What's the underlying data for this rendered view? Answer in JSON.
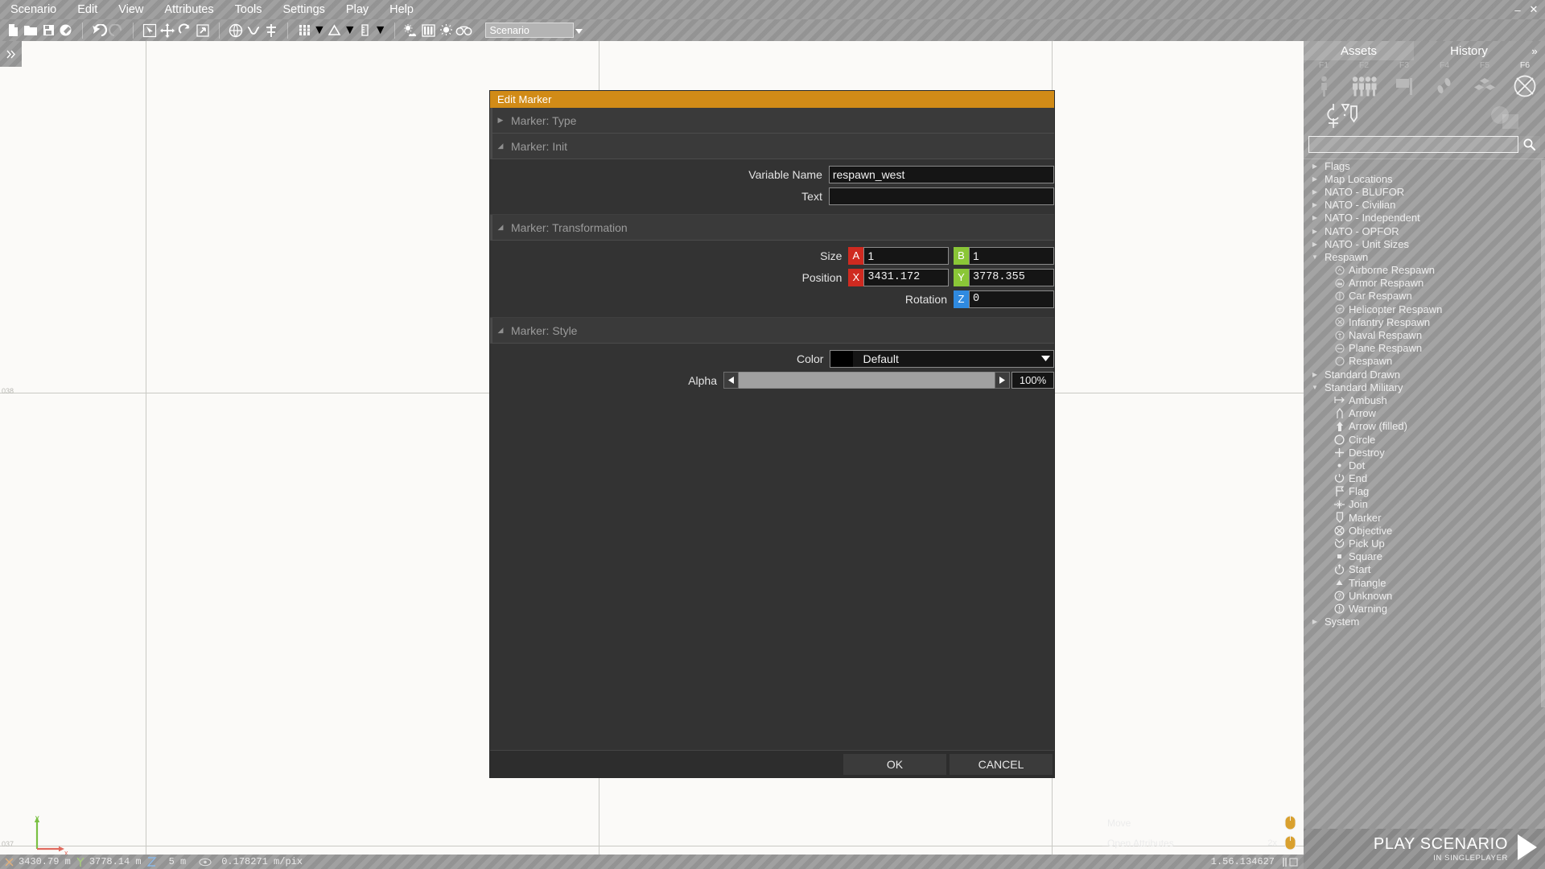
{
  "window": {
    "minimize": "–",
    "maximize": "▫",
    "close": "✕"
  },
  "menubar": {
    "items": [
      "Scenario",
      "Edit",
      "View",
      "Attributes",
      "Tools",
      "Settings",
      "Play",
      "Help"
    ]
  },
  "toolbar": {
    "scenario_combo_value": "Scenario",
    "icons": [
      "new-file-icon",
      "open-folder-icon",
      "save-icon",
      "save-as-icon",
      "undo-icon",
      "redo-icon",
      "select-tool-icon",
      "move-tool-icon",
      "rotate-tool-icon",
      "scale-tool-icon",
      "globe-icon",
      "connect-icon",
      "align-icon",
      "grid-icon",
      "terrain-icon",
      "ruler-icon",
      "environment-icon",
      "texture-icon",
      "lighting-icon",
      "preview-icon"
    ]
  },
  "map": {
    "grid_labels": [
      "038",
      "037"
    ],
    "axis_labels": [
      "y",
      "x"
    ],
    "left_handle_icon": "expand-right-icon"
  },
  "dialog": {
    "title": "Edit Marker",
    "groups": [
      {
        "label": "Marker: Type",
        "expanded": false
      },
      {
        "label": "Marker: Init",
        "expanded": true
      },
      {
        "label": "Marker: Transformation",
        "expanded": true
      },
      {
        "label": "Marker: Style",
        "expanded": true
      }
    ],
    "init": {
      "variable_name_label": "Variable Name",
      "variable_name_value": "respawn_west",
      "text_label": "Text",
      "text_value": "",
      "text_placeholder": ""
    },
    "transformation": {
      "size_label": "Size",
      "size_a_tag": "A",
      "size_a_value": "1",
      "size_b_tag": "B",
      "size_b_value": "1",
      "position_label": "Position",
      "position_x_tag": "X",
      "position_x_value": "3431.172",
      "position_y_tag": "Y",
      "position_y_value": "3778.355",
      "rotation_label": "Rotation",
      "rotation_z_tag": "Z",
      "rotation_z_value": "0"
    },
    "style": {
      "color_label": "Color",
      "color_value": "Default",
      "color_swatch_hex": "#000000",
      "alpha_label": "Alpha",
      "alpha_value": "100%",
      "alpha_percent": 100,
      "decrement_icon": "caret-left-icon",
      "increment_icon": "caret-right-icon",
      "dropdown_icon": "caret-down-icon"
    },
    "buttons": {
      "ok": "OK",
      "cancel": "CANCEL"
    },
    "accent_hex": "#d18b17"
  },
  "right_panel": {
    "tabs": [
      {
        "label": "Assets",
        "active": true
      },
      {
        "label": "History",
        "active": false
      }
    ],
    "expand_icon": "chevron-double-right-icon",
    "fkeys": [
      {
        "label": "F1",
        "active": false
      },
      {
        "label": "F2",
        "active": false
      },
      {
        "label": "F3",
        "active": false
      },
      {
        "label": "F4",
        "active": false
      },
      {
        "label": "F5",
        "active": false
      },
      {
        "label": "F6",
        "active": true
      }
    ],
    "category_icons": [
      "single-unit-icon",
      "group-icon",
      "flag-icon",
      "waypoint-icon",
      "props-icon",
      "marker-crossed-icon"
    ],
    "subcategory_icons": [
      "marker-edit-icon",
      "module-icon"
    ],
    "search": {
      "value": "",
      "placeholder": "",
      "icon": "search-icon"
    },
    "tree": [
      {
        "label": "Flags",
        "type": "branch",
        "expanded": false
      },
      {
        "label": "Map Locations",
        "type": "branch",
        "expanded": false
      },
      {
        "label": "NATO - BLUFOR",
        "type": "branch",
        "expanded": false
      },
      {
        "label": "NATO - Civilian",
        "type": "branch",
        "expanded": false
      },
      {
        "label": "NATO - Independent",
        "type": "branch",
        "expanded": false
      },
      {
        "label": "NATO - OPFOR",
        "type": "branch",
        "expanded": false
      },
      {
        "label": "NATO - Unit Sizes",
        "type": "branch",
        "expanded": false
      },
      {
        "label": "Respawn",
        "type": "branch",
        "expanded": true
      },
      {
        "label": "Airborne Respawn",
        "type": "leaf",
        "icon": "airborne-respawn-icon"
      },
      {
        "label": "Armor Respawn",
        "type": "leaf",
        "icon": "armor-respawn-icon"
      },
      {
        "label": "Car Respawn",
        "type": "leaf",
        "icon": "car-respawn-icon"
      },
      {
        "label": "Helicopter Respawn",
        "type": "leaf",
        "icon": "helicopter-respawn-icon"
      },
      {
        "label": "Infantry Respawn",
        "type": "leaf",
        "icon": "infantry-respawn-icon"
      },
      {
        "label": "Naval Respawn",
        "type": "leaf",
        "icon": "naval-respawn-icon"
      },
      {
        "label": "Plane Respawn",
        "type": "leaf",
        "icon": "plane-respawn-icon"
      },
      {
        "label": "Respawn",
        "type": "leaf",
        "icon": "respawn-icon"
      },
      {
        "label": "Standard Drawn",
        "type": "branch",
        "expanded": false
      },
      {
        "label": "Standard Military",
        "type": "branch",
        "expanded": true
      },
      {
        "label": "Ambush",
        "type": "leaf",
        "icon": "ambush-icon"
      },
      {
        "label": "Arrow",
        "type": "leaf",
        "icon": "arrow-icon"
      },
      {
        "label": "Arrow (filled)",
        "type": "leaf",
        "icon": "arrow-filled-icon"
      },
      {
        "label": "Circle",
        "type": "leaf",
        "icon": "circle-icon"
      },
      {
        "label": "Destroy",
        "type": "leaf",
        "icon": "destroy-icon"
      },
      {
        "label": "Dot",
        "type": "leaf",
        "icon": "dot-icon"
      },
      {
        "label": "End",
        "type": "leaf",
        "icon": "end-icon"
      },
      {
        "label": "Flag",
        "type": "leaf",
        "icon": "flag-marker-icon"
      },
      {
        "label": "Join",
        "type": "leaf",
        "icon": "join-icon"
      },
      {
        "label": "Marker",
        "type": "leaf",
        "icon": "marker-icon"
      },
      {
        "label": "Objective",
        "type": "leaf",
        "icon": "objective-icon"
      },
      {
        "label": "Pick Up",
        "type": "leaf",
        "icon": "pickup-icon"
      },
      {
        "label": "Square",
        "type": "leaf",
        "icon": "square-icon"
      },
      {
        "label": "Start",
        "type": "leaf",
        "icon": "start-icon"
      },
      {
        "label": "Triangle",
        "type": "leaf",
        "icon": "triangle-icon"
      },
      {
        "label": "Unknown",
        "type": "leaf",
        "icon": "unknown-icon"
      },
      {
        "label": "Warning",
        "type": "leaf",
        "icon": "warning-icon"
      },
      {
        "label": "System",
        "type": "branch",
        "expanded": false
      }
    ]
  },
  "hints": [
    {
      "label": "Move",
      "key": "",
      "icon": "mouse-left-icon"
    },
    {
      "label": "Open Attributes",
      "key": "2x",
      "icon": "mouse-left-icon"
    }
  ],
  "statusbar": {
    "x_label": "X",
    "x_value": "3430.79 m",
    "y_label": "Y",
    "y_value": "3778.14 m",
    "z_label": "Z",
    "grid_value": "5 m",
    "scale_value": "0.178271 m/pix",
    "time_value": "1.56.134627",
    "eye_icon": "eye-icon"
  },
  "play": {
    "title": "PLAY SCENARIO",
    "subtitle": "IN SINGLEPLAYER",
    "icon": "play-triangle-icon"
  }
}
